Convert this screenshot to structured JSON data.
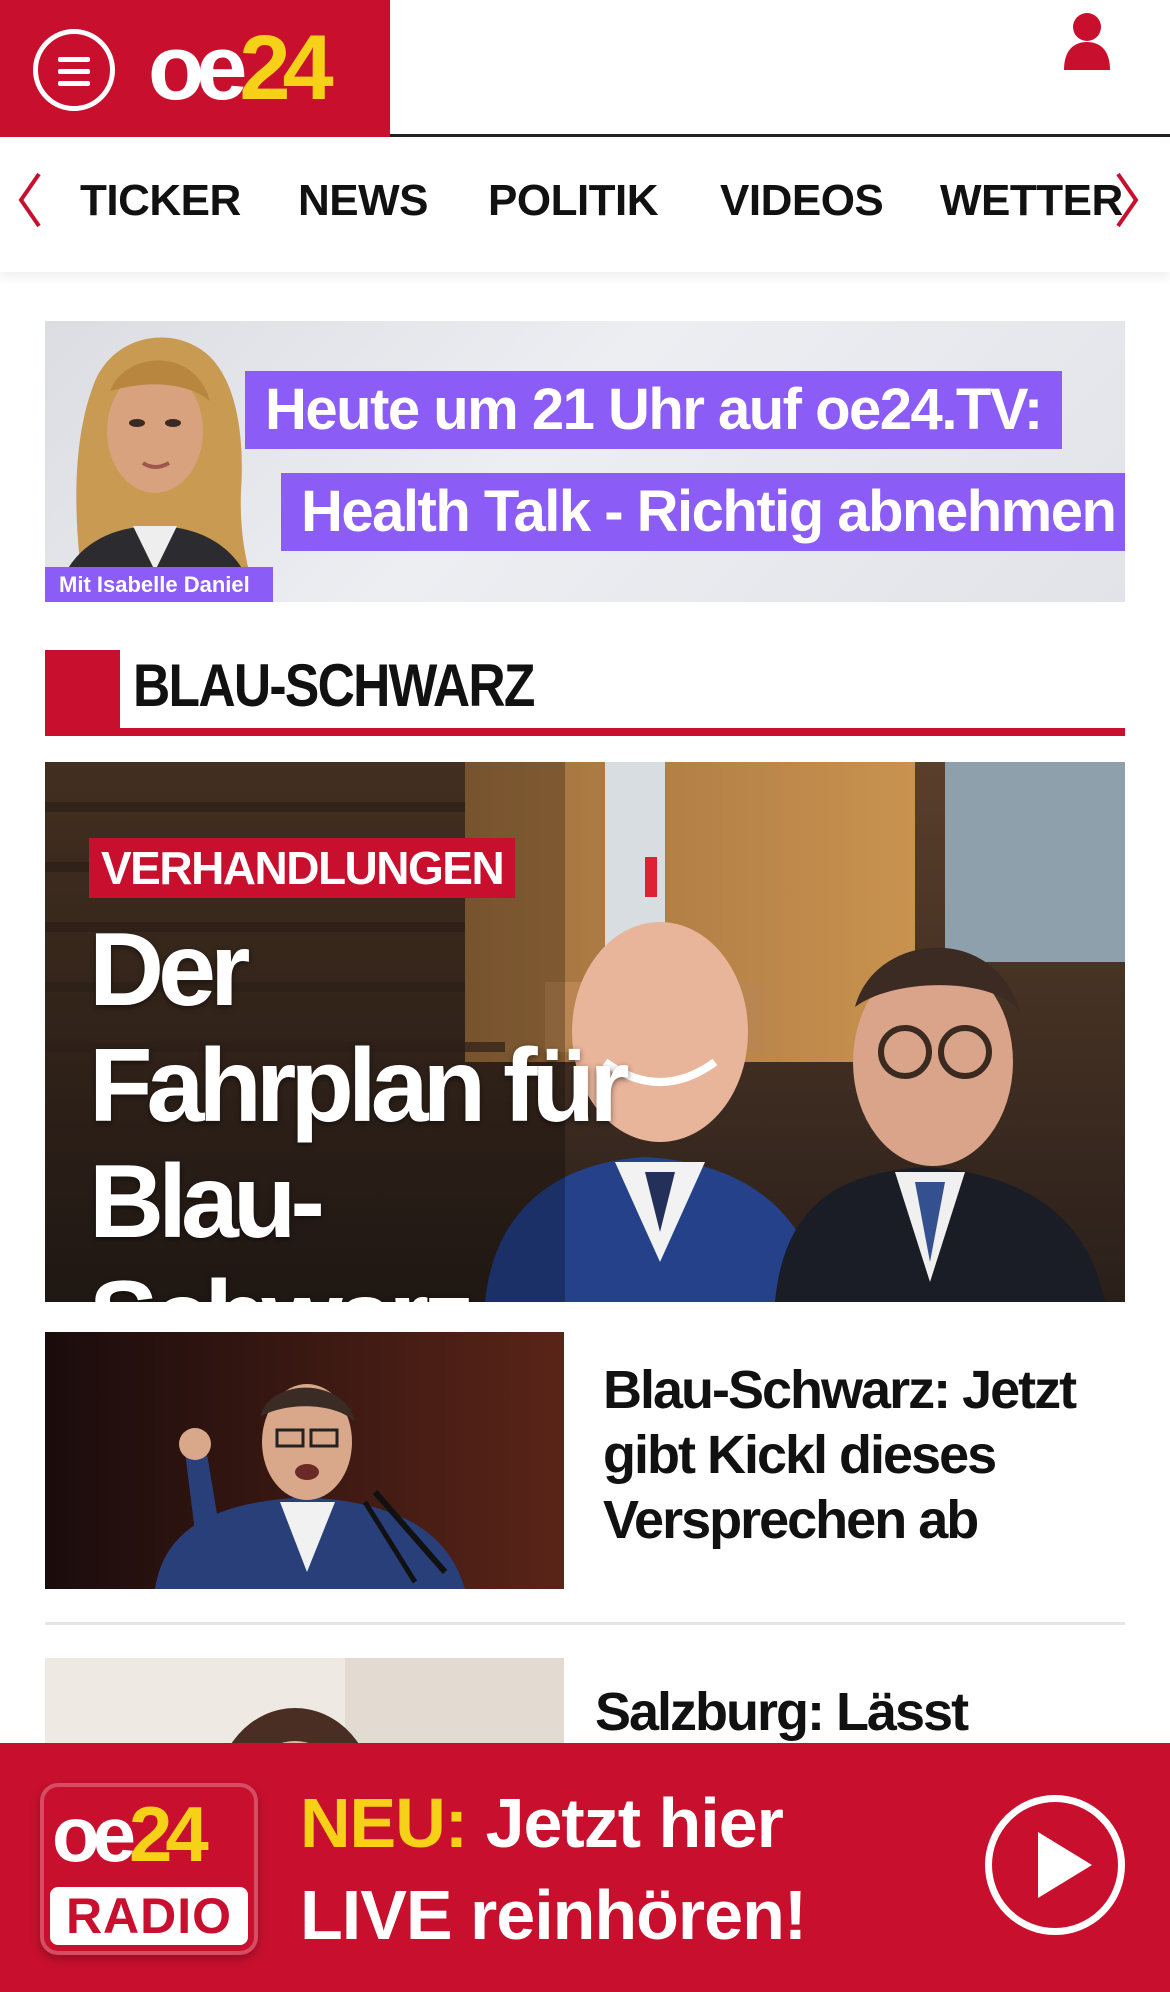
{
  "header": {
    "logo_oe": "oe",
    "logo_num": "24",
    "menu_icon": "hamburger-menu-icon",
    "user_icon": "user-icon"
  },
  "nav": {
    "items": [
      "TICKER",
      "NEWS",
      "POLITIK",
      "VIDEOS",
      "WETTER"
    ]
  },
  "promo": {
    "line1": "Heute um 21 Uhr auf oe24.TV:",
    "line2": "Health Talk - Richtig abnehmen",
    "caption": "Mit Isabelle Daniel"
  },
  "section": {
    "title": "BLAU-SCHWARZ"
  },
  "hero": {
    "badge": "VERHANDLUNGEN",
    "title": "Der Fahrplan für Blau-Schwarz"
  },
  "articles": [
    {
      "title": "Blau-Schwarz: Jetzt gibt Kickl dieses Versprechen ab"
    },
    {
      "title": "Salzburg: Lässt Svazek"
    }
  ],
  "radio": {
    "logo_oe": "oe",
    "logo_num": "24",
    "logo_radio": "RADIO",
    "neu": "NEU:",
    "line1": "Jetzt hier",
    "line2": "LIVE reinhören!",
    "play_icon": "play-icon"
  },
  "colors": {
    "brand_red": "#c8102e",
    "brand_yellow": "#f7d117",
    "promo_purple": "#8b5cf6"
  }
}
